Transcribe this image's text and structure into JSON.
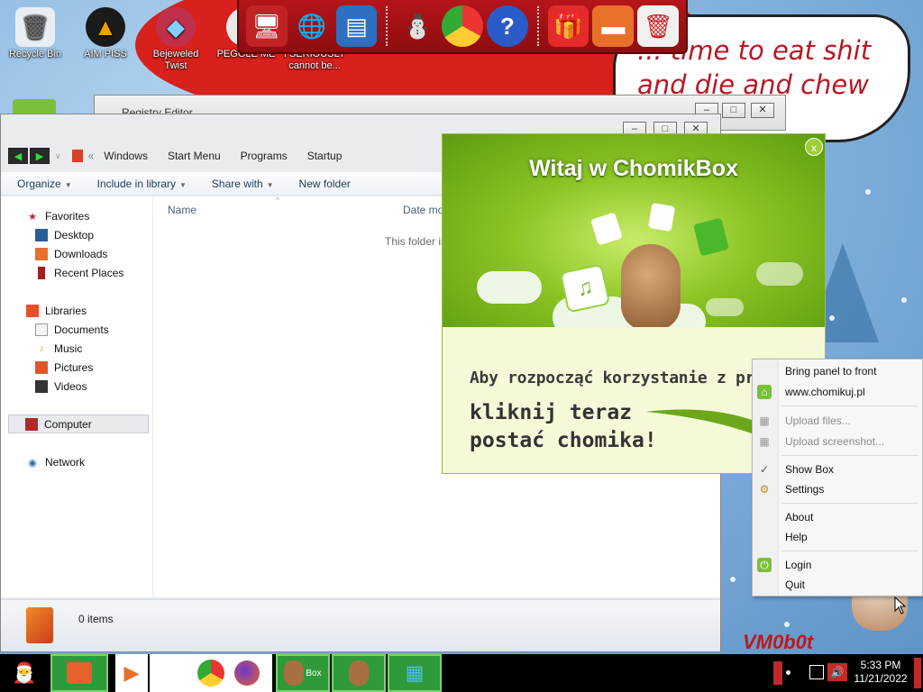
{
  "desktop": {
    "icons": [
      {
        "label": "Recycle Bin",
        "icon": "recycle-bin-icon"
      },
      {
        "label": "AIM PISS",
        "icon": "aim-icon"
      },
      {
        "label": "Bejeweled Twist",
        "icon": "bejeweled-icon"
      },
      {
        "label": "PEGGLE ME",
        "icon": "peggle-icon"
      },
      {
        "label": "I SERIOUSLY cannot be...",
        "icon": "text-file-icon"
      }
    ],
    "bubble_text": "... time to eat shit and die and chew ...es",
    "watermark": "VM0b0t"
  },
  "dock": {
    "items": [
      "christmas-monitor-icon",
      "globe-icon",
      "network-icon",
      "snowman-icon",
      "chrome-like-icon",
      "help-icon",
      "gift-icon",
      "folder-icon",
      "recycle-bin-icon"
    ]
  },
  "regedit": {
    "title": "Registry Editor"
  },
  "explorer": {
    "breadcrumb": [
      "Windows",
      "Start Menu",
      "Programs",
      "Startup"
    ],
    "toolbar": [
      {
        "label": "Organize",
        "dropdown": true
      },
      {
        "label": "Include in library",
        "dropdown": true
      },
      {
        "label": "Share with",
        "dropdown": true
      },
      {
        "label": "New folder",
        "dropdown": false
      }
    ],
    "nav": {
      "favorites": "Favorites",
      "desktop": "Desktop",
      "downloads": "Downloads",
      "recent": "Recent Places",
      "libraries": "Libraries",
      "documents": "Documents",
      "music": "Music",
      "pictures": "Pictures",
      "videos": "Videos",
      "computer": "Computer",
      "network": "Network"
    },
    "columns": {
      "name": "Name",
      "date": "Date mo"
    },
    "empty_text": "This folder is",
    "status": "0 items"
  },
  "chomikbox": {
    "title": "Witaj w ChomikBox",
    "line1": "Aby rozpocząć korzystanie z programu,",
    "line2": "kliknij teraz",
    "line3": "postać chomika!",
    "close": "x"
  },
  "context_menu": {
    "bring_front": "Bring panel to front",
    "website": "www.chomikuj.pl",
    "upload_files": "Upload files...",
    "upload_screenshot": "Upload screenshot...",
    "show_box": "Show Box",
    "settings": "Settings",
    "about": "About",
    "help": "Help",
    "login": "Login",
    "quit": "Quit"
  },
  "taskbar": {
    "time": "5:33 PM",
    "date": "11/21/2022",
    "box_label": "Box"
  },
  "colors": {
    "chomik_green": "#8cc424",
    "dock_red": "#b4151a",
    "taskbar_green": "#2f9a3a"
  }
}
